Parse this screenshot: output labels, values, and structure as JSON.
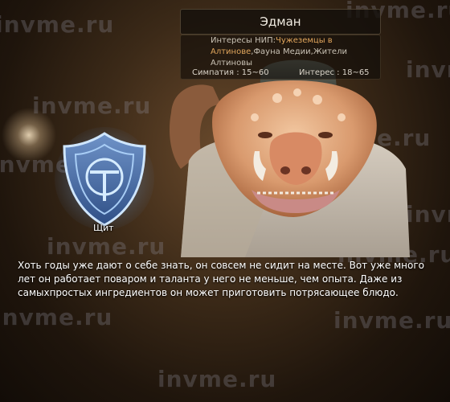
{
  "npc": {
    "name": "Эдман",
    "interests_label": "Интересы НИП:",
    "interests_value_1": "Чужеземцы в Алтинове",
    "interests_value_2": ",Фауна Медии,Жители Алтиновы",
    "sympathy": "Симпатия : 15~60",
    "interest": "Интерес : 18~65"
  },
  "shield": {
    "label": "Щит",
    "icon": "shield-icon"
  },
  "description": "Хоть годы уже дают о себе знать, он совсем не сидит на месте. Вот уже много лет он работает поваром и таланта у него не меньше, чем опыта. Даже из самыхпростых ингредиентов он может приготовить потрясающее блюдо.",
  "watermark": "invme.ru",
  "colors": {
    "highlight": "#e0a55c",
    "panel": "#120e0a",
    "text": "#ffffff"
  }
}
